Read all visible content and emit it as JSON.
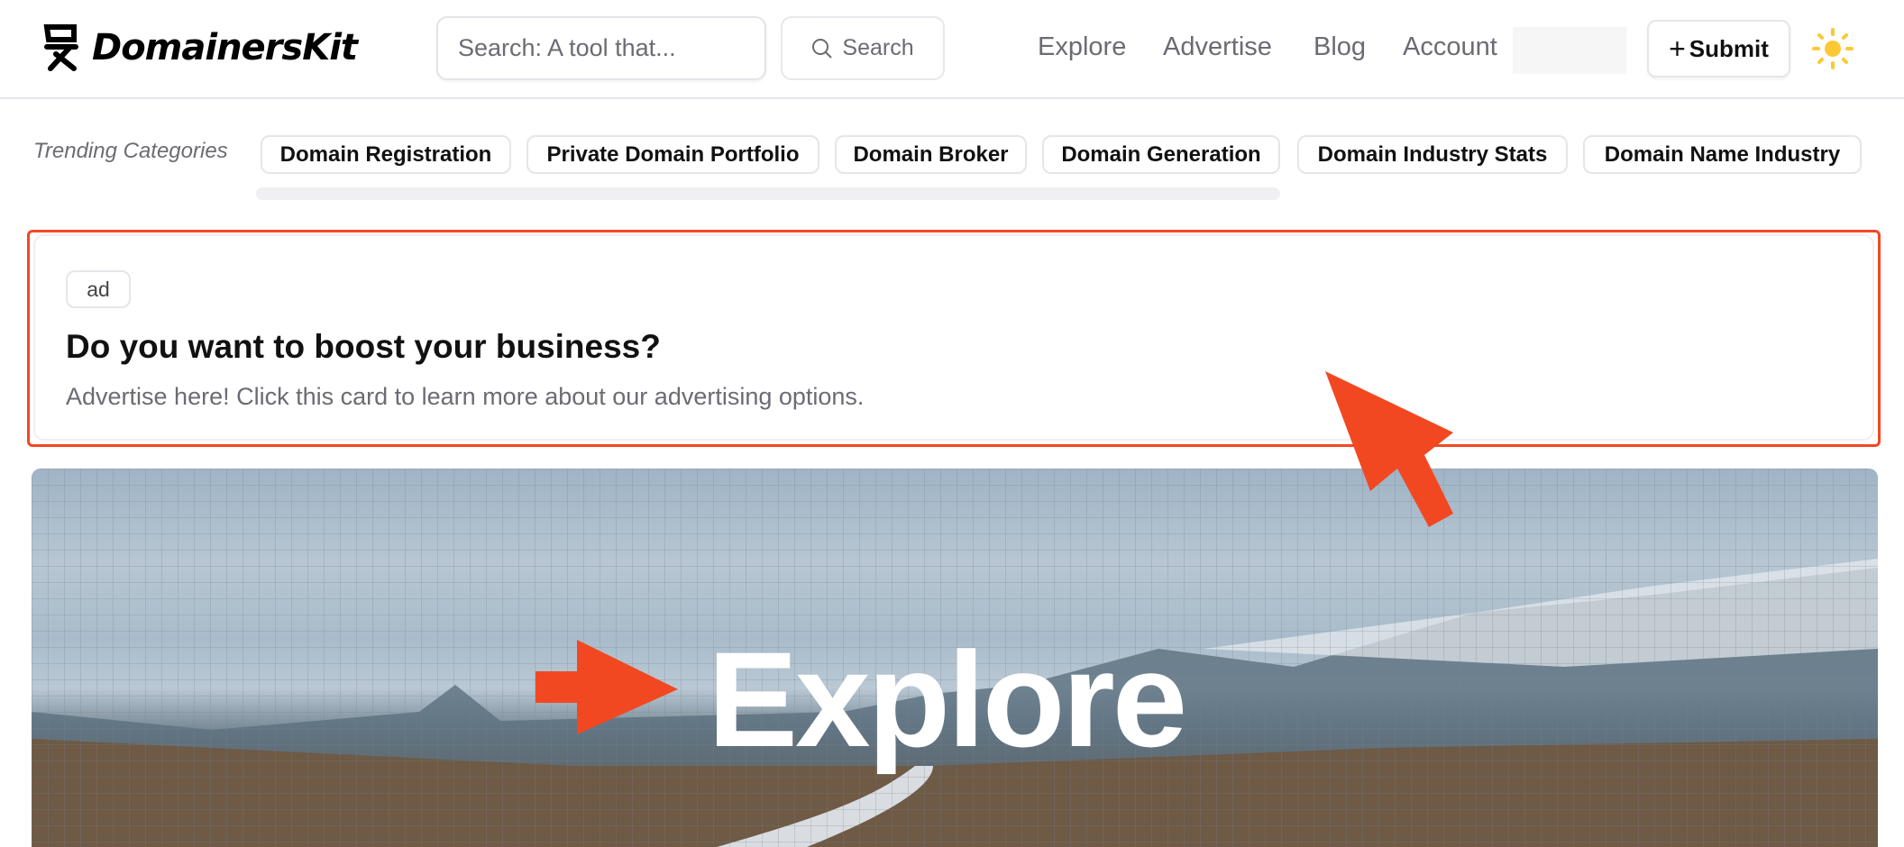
{
  "header": {
    "logo_text": "DomainersKit",
    "search_placeholder": "Search: A tool that...",
    "search_button": "Search",
    "nav": [
      "Explore",
      "Advertise",
      "Blog",
      "Account"
    ],
    "submit_label": "Submit",
    "theme_icon": "sun-icon"
  },
  "trending": {
    "label": "Trending Categories",
    "chips": [
      "Domain Registration",
      "Private Domain Portfolio",
      "Domain Broker",
      "Domain Generation",
      "Domain Industry Stats",
      "Domain Name Industry"
    ]
  },
  "ad": {
    "badge": "ad",
    "title": "Do you want to boost your business?",
    "description": "Advertise here! Click this card to learn more about our advertising options."
  },
  "hero": {
    "title": "Explore"
  },
  "colors": {
    "annotation": "#f24822",
    "sun": "#fcc935"
  }
}
